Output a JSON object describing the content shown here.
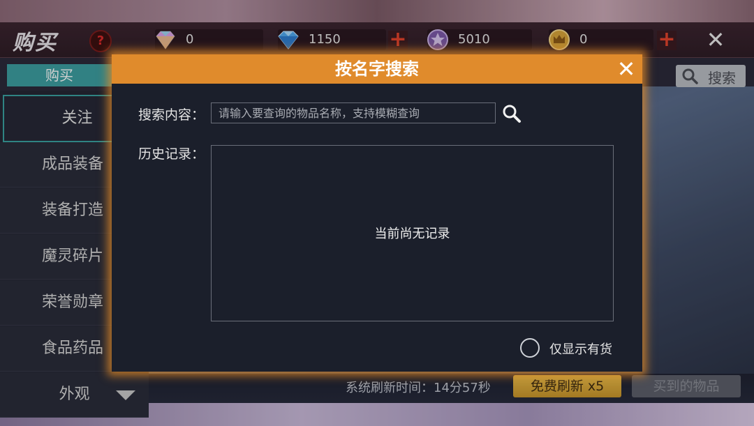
{
  "shop": {
    "title": "购买",
    "help_label": "?",
    "close_label": "✕",
    "currencies": [
      {
        "name": "rainbow-diamond",
        "value": "0",
        "color": "#d9a0e6",
        "has_plus": false
      },
      {
        "name": "blue-diamond",
        "value": "1150",
        "color": "#4fa8ee",
        "has_plus": true
      },
      {
        "name": "star-token",
        "value": "5010",
        "color": "#9a78c8",
        "has_plus": false
      },
      {
        "name": "crown-coin",
        "value": "0",
        "color": "#d7a43a",
        "has_plus": true
      }
    ],
    "plus_label": "+"
  },
  "tabs": {
    "buy": "购买",
    "search": "搜索"
  },
  "sidebar": {
    "items": [
      {
        "label": "关注",
        "active": true
      },
      {
        "label": "成品装备",
        "active": false
      },
      {
        "label": "装备打造",
        "active": false
      },
      {
        "label": "魔灵碎片",
        "active": false
      },
      {
        "label": "荣誉勋章",
        "active": false
      },
      {
        "label": "食品药品",
        "active": false
      },
      {
        "label": "外观",
        "active": false
      }
    ]
  },
  "bottom": {
    "refresh_time": "系统刷新时间：14分57秒",
    "free_refresh": "免费刷新 x5",
    "bought_items": "买到的物品"
  },
  "modal": {
    "title": "按名字搜索",
    "close_label": "✕",
    "search_label": "搜索内容：",
    "search_placeholder": "请输入要查询的物品名称，支持模糊查询",
    "search_value": "",
    "history_label": "历史记录：",
    "history_empty": "当前尚无记录",
    "instock_label": "仅显示有货",
    "instock_checked": false
  },
  "colors": {
    "accent_orange": "#e08b2c",
    "tab_teal": "#3c9ea0",
    "gold_button": "#e8bd4b"
  }
}
